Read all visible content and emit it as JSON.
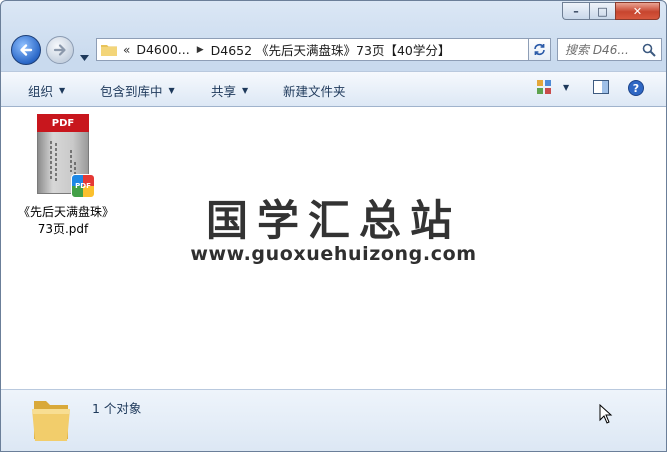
{
  "window": {
    "controls": {
      "minimize": "–",
      "maximize": "□",
      "close": "✕"
    }
  },
  "navigation": {
    "breadcrumb": {
      "overflow": "«",
      "segments": [
        "D4600...",
        "D4652 《先后天满盘珠》73页【40学分】"
      ]
    },
    "search": {
      "placeholder": "搜索 D46..."
    }
  },
  "commands": {
    "organize": "组织",
    "include_in_library": "包含到库中",
    "share": "共享",
    "new_folder": "新建文件夹"
  },
  "files": [
    {
      "name": "《先后天满盘珠》73页.pdf",
      "thumbnail_label": "PDF",
      "badge_label": "PDF"
    }
  ],
  "watermark": {
    "chinese": "国学汇总站",
    "url": "www.guoxuehuizong.com"
  },
  "details": {
    "count": "1 个对象"
  },
  "colors": {
    "accent": "#1e395b",
    "pdf_red": "#c8161d",
    "close_red": "#c7452f"
  }
}
